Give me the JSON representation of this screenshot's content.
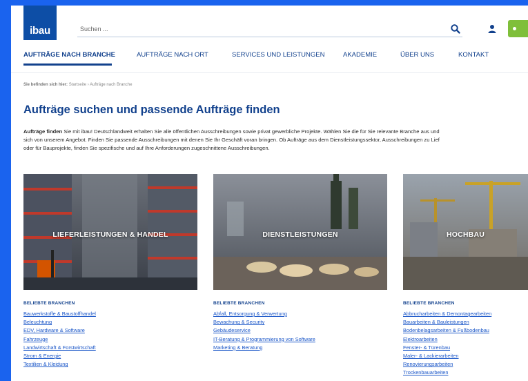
{
  "header": {
    "logo_text": "ibau",
    "search": {
      "placeholder": "Suchen ..."
    },
    "icons": [
      "search-icon",
      "user-icon"
    ],
    "accent_color": "#7fbf3a",
    "brand_color": "#0d4ea6"
  },
  "nav": {
    "items": [
      {
        "label": "AUFTRÄGE NACH BRANCHE"
      },
      {
        "label": "AUFTRÄGE NACH ORT"
      },
      {
        "label": "SERVICES UND LEISTUNGEN"
      },
      {
        "label": "AKADEMIE"
      },
      {
        "label": "ÜBER UNS"
      },
      {
        "label": "KONTAKT"
      }
    ],
    "active": "AUFTRÄGE NACH BRANCHE"
  },
  "breadcrumb": {
    "prefix": "Sie befinden sich hier:",
    "items": [
      "Startseite",
      "Aufträge nach Branche"
    ],
    "separator": "›"
  },
  "main": {
    "title": "Aufträge suchen und passende Aufträge finden",
    "intro_bold": "Aufträge finden",
    "intro_line1": " Sie mit ibau! Deutschlandweit erhalten Sie alle öffentlichen Ausschreibungen sowie privat gewerbliche Projekte. Wählen Sie die für Sie relevante Branche aus und",
    "intro_line2": "sich von unserem Angebot. Finden Sie passende Ausschreibungen mit denen Sie Ihr Geschäft voran bringen. Ob Aufträge aus dem Dienstleistungssektor, Ausschreibungen zu Lief",
    "intro_line3": "oder für Bauprojekte, finden Sie spezifische und auf Ihre Anforderungen zugeschnittene Ausschreibungen."
  },
  "categories": [
    {
      "title": "LIEFERLEISTUNGEN & HANDEL",
      "heading": "BELIEBTE BRANCHEN",
      "links": [
        "Bauwerkstoffe & Baustoffhandel",
        "Beleuchtung",
        "EDV, Hardware & Software",
        "Fahrzeuge",
        "Landwirtschaft & Forstwirtschaft",
        "Strom & Energie",
        "Textilien & Kleidung"
      ]
    },
    {
      "title": "DIENSTLEISTUNGEN",
      "heading": "BELIEBTE BRANCHEN",
      "links": [
        "Abfall, Entsorgung & Verwertung",
        "Bewachung & Security",
        "Gebäudeservice",
        "IT-Beratung & Programmierung von Software",
        "Marketing & Beratung"
      ]
    },
    {
      "title": "HOCHBAU",
      "heading": "BELIEBTE BRANCHEN",
      "links": [
        "Abbrucharbeiten & Demontagearbeiten",
        "Bauarbeiten & Bauleistungen",
        "Bodenbelagsarbeiten & Fußbodenbau",
        "Elektroarbeiten",
        "Fenster- & Türenbau",
        "Maler- & Lackierarbeiten",
        "Renovierungsarbeiten",
        "Trockenbauarbeiten"
      ]
    }
  ]
}
